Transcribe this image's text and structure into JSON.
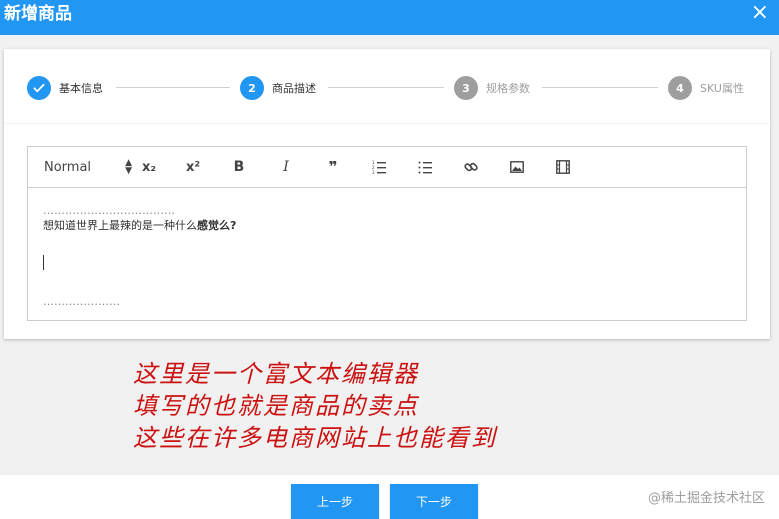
{
  "dialog": {
    "title": "新增商品",
    "close_icon": "×"
  },
  "stepper": {
    "steps": [
      {
        "number": "✓",
        "label": "基本信息",
        "state": "done"
      },
      {
        "number": "2",
        "label": "商品描述",
        "state": "active"
      },
      {
        "number": "3",
        "label": "规格参数",
        "state": "pending"
      },
      {
        "number": "4",
        "label": "SKU属性",
        "state": "pending"
      }
    ]
  },
  "editor": {
    "toolbar": {
      "format_select": "Normal",
      "subscript": "x₂",
      "superscript": "x²",
      "bold": "B",
      "italic": "I",
      "quote": "❞",
      "ordered_list_icon": "ordered-list-icon",
      "bullet_list_icon": "bullet-list-icon",
      "link_icon": "link-icon",
      "image_icon": "image-icon",
      "video_icon": "video-icon"
    },
    "content": {
      "dots_top": "………………………………",
      "line_plain": "想知道世界上最辣的是一种什么",
      "line_bold": "感觉么?",
      "dots_bottom": "…………………"
    }
  },
  "annotation": {
    "lines": [
      "这里是一个富文本编辑器",
      "填写的也就是商品的卖点",
      "这些在许多电商网站上也能看到"
    ],
    "color": "#cc1111"
  },
  "footer": {
    "prev_label": "上一步",
    "next_label": "下一步",
    "watermark": "@稀土掘金技术社区"
  },
  "colors": {
    "primary": "#2196f3",
    "inactive": "#9e9e9e"
  }
}
